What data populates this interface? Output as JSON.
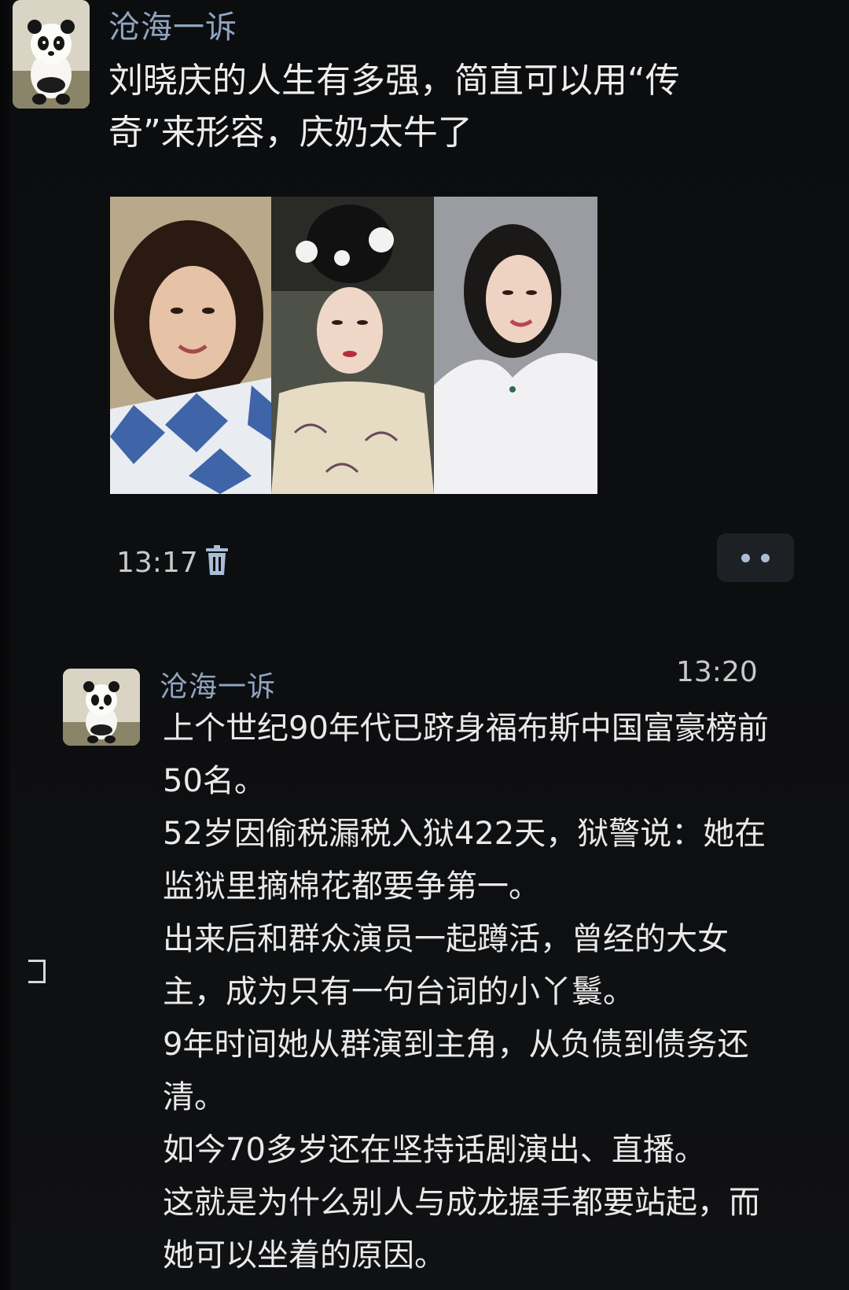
{
  "messages": [
    {
      "sender": "沧海一诉",
      "text": "刘晓庆的人生有多强，简直可以用“传奇”来形容，庆奶太牛了",
      "time": "13:17",
      "photos": [
        "portrait-young",
        "portrait-costume",
        "portrait-white-dress"
      ]
    },
    {
      "sender": "沧海一诉",
      "time": "13:20",
      "lines": [
        "上个世纪90年代已跻身福布斯中国富豪榜前50名。",
        "52岁因偷税漏税入狱422天，狱警说：她在监狱里摘棉花都要争第一。",
        "出来后和群众演员一起蹲活，曾经的大女主，成为只有一句台词的小丫鬟。",
        "9年时间她从群演到主角，从负债到债务还清。",
        "如今70多岁还在坚持话剧演出、直播。",
        "这就是为什么别人与成龙握手都要站起，而她可以坐着的原因。"
      ]
    }
  ],
  "icons": {
    "delete": "trash-icon",
    "more": "more-dots-icon"
  },
  "colors": {
    "background": "#0b0c0e",
    "sender_name": "#8fa4bf",
    "message_text": "#ededed",
    "more_button_bg": "#1d2125"
  }
}
